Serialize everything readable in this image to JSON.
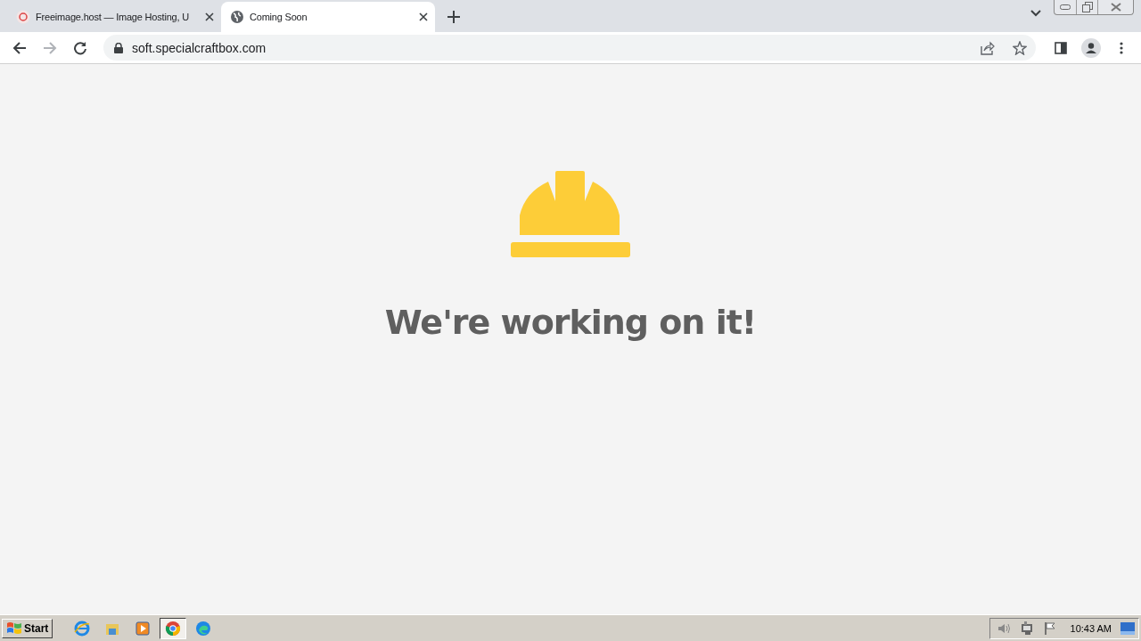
{
  "browser": {
    "tabs": [
      {
        "title": "Freeimage.host — Image Hosting, U",
        "kind": "freeimage",
        "selected": false
      },
      {
        "title": "Coming Soon",
        "kind": "globe",
        "selected": true
      }
    ],
    "address": "soft.specialcraftbox.com"
  },
  "page": {
    "heading": "We're working on it!"
  },
  "taskbar": {
    "start": "Start",
    "apps": [
      {
        "kind": "ie",
        "selected": false
      },
      {
        "kind": "folder",
        "selected": false
      },
      {
        "kind": "media",
        "selected": false
      },
      {
        "kind": "chrome",
        "selected": true
      },
      {
        "kind": "edge",
        "selected": false
      }
    ],
    "clock": "10:43 AM"
  }
}
